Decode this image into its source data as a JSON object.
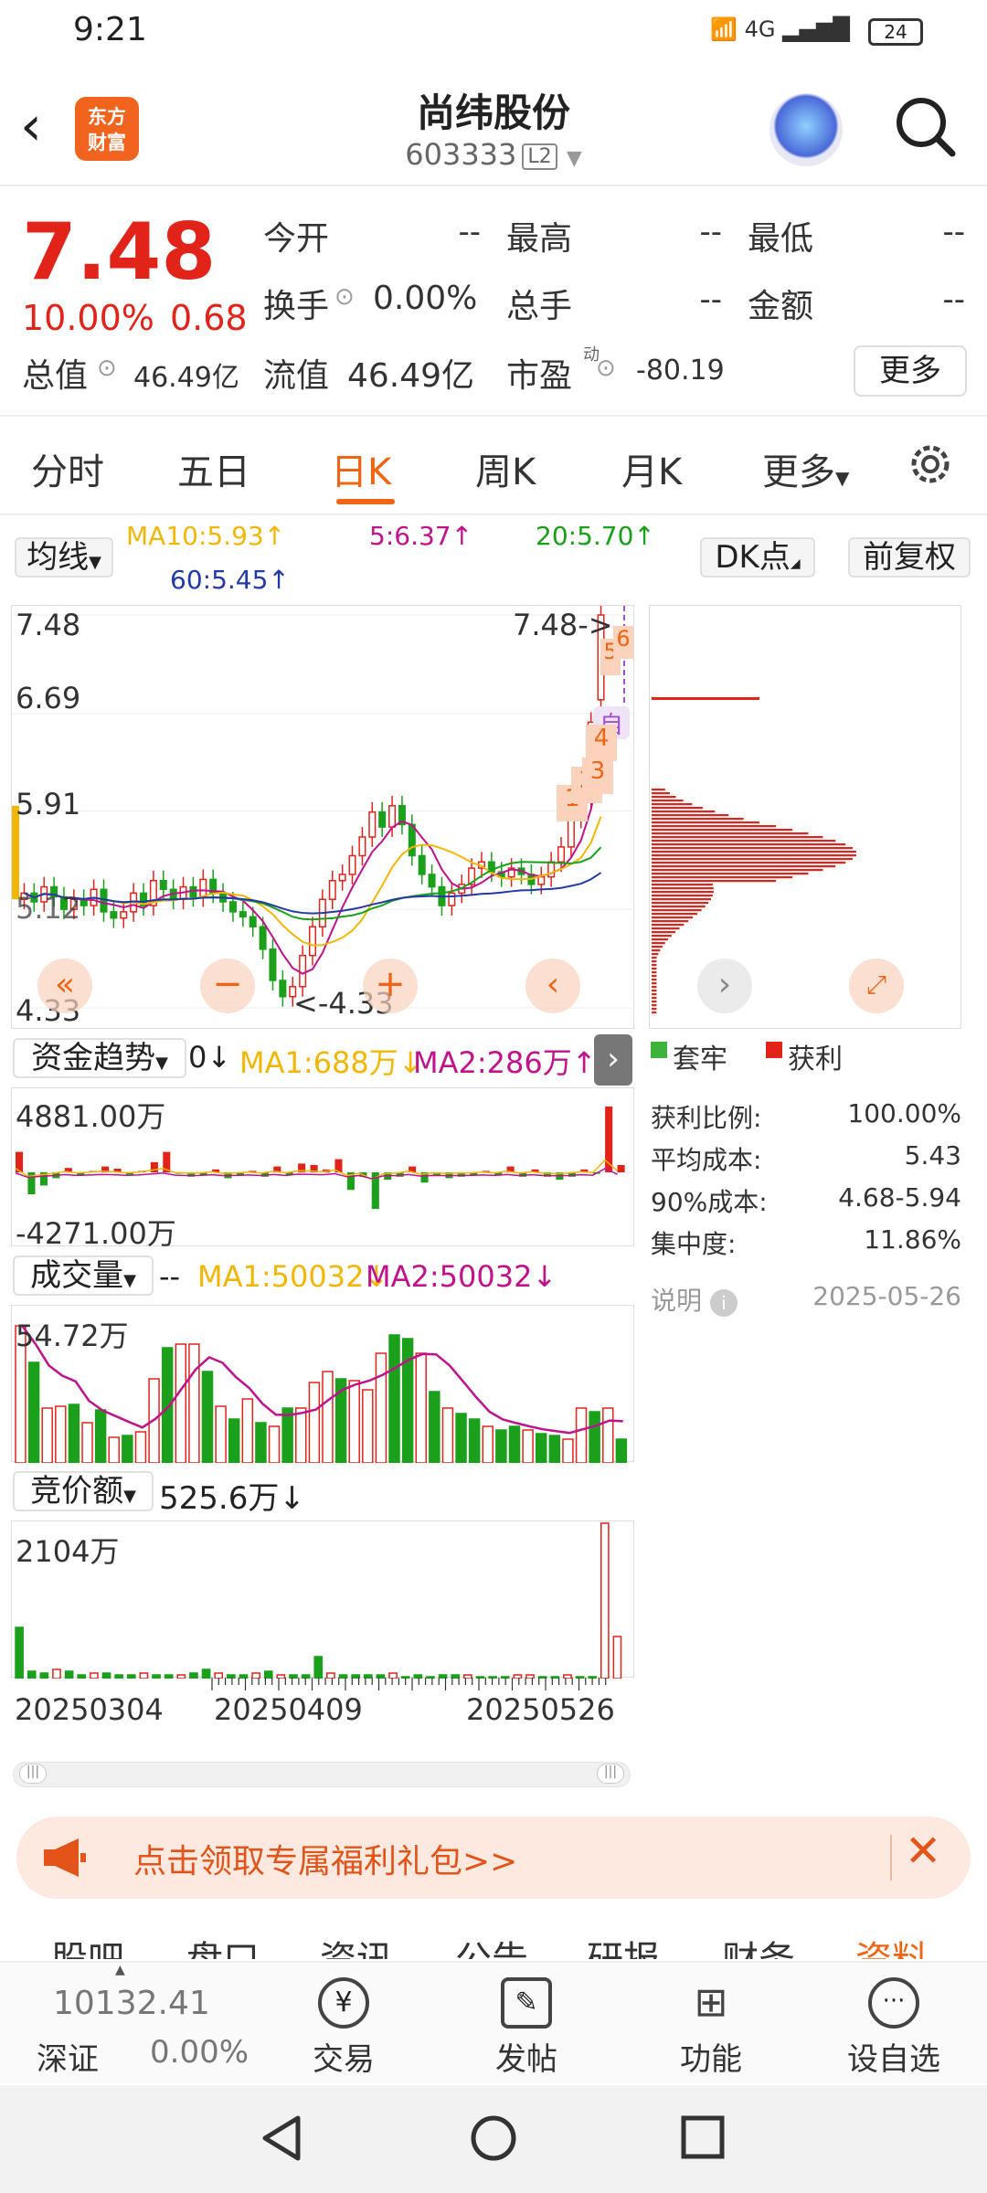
{
  "status": {
    "time": "9:21",
    "network": "4G",
    "battery": "24"
  },
  "header": {
    "title": "尚纬股份",
    "code": "603333",
    "level": "L2",
    "logo_line1": "东方",
    "logo_line2": "财富"
  },
  "quote": {
    "price": "7.48",
    "pct": "10.00%",
    "change": "0.68",
    "open_label": "今开",
    "open": "--",
    "high_label": "最高",
    "high": "--",
    "low_label": "最低",
    "low": "--",
    "turnover_label": "换手",
    "turnover": "0.00%",
    "volume_label": "总手",
    "volume": "--",
    "amount_label": "金额",
    "amount": "--",
    "mcap_label": "总值",
    "mcap": "46.49亿",
    "float_label": "流值",
    "float": "46.49亿",
    "pe_label": "市盈",
    "pe_sup": "动",
    "pe": "-80.19",
    "more": "更多"
  },
  "tabs": [
    "分时",
    "五日",
    "日K",
    "周K",
    "月K",
    "更多"
  ],
  "active_tab": 2,
  "ma": {
    "selector": "均线",
    "ma10": "MA10:5.93↑",
    "ma5": "5:6.37↑",
    "ma20": "20:5.70↑",
    "ma60": "60:5.45↑",
    "dk": "DK点",
    "adjust": "前复权"
  },
  "kchart": {
    "y_top": "7.48",
    "y_2": "6.69",
    "y_3": "5.91",
    "y_4": "5.12",
    "y_bottom": "4.33",
    "max_label": "7.48->",
    "min_label": "<-4.33",
    "self_tag": "自",
    "signals": [
      "1",
      "2",
      "3",
      "4",
      "5",
      "6"
    ]
  },
  "chart_data": [
    {
      "type": "candlestick",
      "title": "日K",
      "ylim": [
        4.33,
        7.48
      ],
      "y_ticks": [
        "7.48",
        "6.69",
        "5.91",
        "5.12",
        "4.33"
      ],
      "x_ticks": [
        "20250304",
        "20250409",
        "20250526"
      ],
      "close": [
        5.25,
        5.18,
        5.3,
        5.22,
        5.12,
        5.2,
        5.15,
        5.28,
        5.1,
        5.05,
        5.1,
        5.25,
        5.15,
        5.35,
        5.28,
        5.2,
        5.3,
        5.22,
        5.36,
        5.25,
        5.18,
        5.1,
        5.06,
        4.98,
        4.8,
        4.55,
        4.42,
        4.5,
        4.75,
        4.98,
        5.2,
        5.35,
        5.4,
        5.55,
        5.7,
        5.9,
        5.78,
        5.95,
        5.8,
        5.55,
        5.4,
        5.3,
        5.15,
        5.25,
        5.32,
        5.45,
        5.5,
        5.42,
        5.38,
        5.45,
        5.4,
        5.32,
        5.38,
        5.5,
        5.62,
        5.85,
        6.02,
        6.62,
        7.48
      ],
      "open": [
        5.2,
        5.25,
        5.18,
        5.3,
        5.22,
        5.12,
        5.2,
        5.15,
        5.28,
        5.1,
        5.05,
        5.1,
        5.25,
        5.15,
        5.35,
        5.28,
        5.2,
        5.3,
        5.22,
        5.36,
        5.25,
        5.18,
        5.1,
        5.06,
        4.98,
        4.8,
        4.55,
        4.42,
        4.5,
        4.75,
        4.98,
        5.2,
        5.35,
        5.4,
        5.55,
        5.7,
        5.9,
        5.78,
        5.95,
        5.8,
        5.55,
        5.4,
        5.3,
        5.15,
        5.25,
        5.32,
        5.45,
        5.5,
        5.42,
        5.38,
        5.45,
        5.4,
        5.32,
        5.38,
        5.5,
        5.62,
        5.85,
        6.02,
        6.8
      ],
      "ma5": "6.37",
      "ma10": "5.93",
      "ma20": "5.70",
      "ma60": "5.45"
    },
    {
      "type": "bar",
      "title": "资金趋势",
      "y_max": "4881.00万",
      "y_min": "-4271.00万",
      "value": "0",
      "ma1": "MA1:688万",
      "ma2": "MA2:286万"
    },
    {
      "type": "bar",
      "title": "成交量",
      "y_max": "54.72万",
      "value": "--",
      "ma1": "MA1:50032",
      "ma2": "MA2:50032"
    },
    {
      "type": "bar",
      "title": "竞价额",
      "y_max": "2104万",
      "value": "525.6万"
    }
  ],
  "fund": {
    "label": "资金趋势",
    "value": "0↓",
    "ma1": "MA1:688万↓",
    "ma2": "MA2:286万↑",
    "ymax": "4881.00万",
    "ymin": "-4271.00万"
  },
  "volume": {
    "label": "成交量",
    "value": "--",
    "ma1": "MA1:50032↓",
    "ma2": "MA2:50032↓",
    "ymax": "54.72万"
  },
  "auction": {
    "label": "竞价额",
    "value": "525.6万↓",
    "ymax": "2104万"
  },
  "dates": [
    "20250304",
    "20250409",
    "20250526"
  ],
  "chip": {
    "legend_trap": "套牢",
    "legend_profit": "获利",
    "profit_ratio_label": "获利比例:",
    "profit_ratio": "100.00%",
    "avg_cost_label": "平均成本:",
    "avg_cost": "5.43",
    "cost90_label": "90%成本:",
    "cost90": "4.68-5.94",
    "concentration_label": "集中度:",
    "concentration": "11.86%",
    "note": "说明",
    "date": "2025-05-26"
  },
  "banner": {
    "text": "点击领取专属福利礼包>>"
  },
  "subtabs": [
    "股吧",
    "盘口",
    "资讯",
    "公告",
    "研报",
    "财务",
    "资料"
  ],
  "bottom": {
    "index_value": "10132.41",
    "index_name": "深证",
    "index_pct": "0.00%",
    "trade": "交易",
    "post": "发帖",
    "func": "功能",
    "watch": "设自选"
  },
  "colors": {
    "up": "#e2231a",
    "down": "#1aa01a",
    "accent": "#f06414",
    "ma5": "#c0128a",
    "ma10": "#f2b705",
    "ma20": "#18a018",
    "ma60": "#2339a8"
  }
}
